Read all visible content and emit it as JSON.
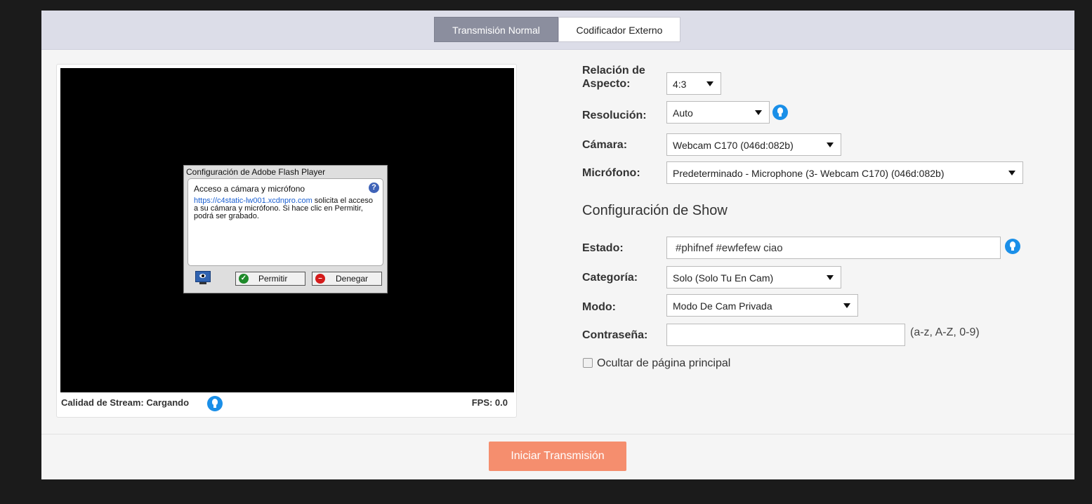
{
  "tabs": [
    {
      "label": "Transmisión Normal",
      "active": true
    },
    {
      "label": "Codificador Externo",
      "active": false
    }
  ],
  "flash_dialog": {
    "title": "Configuración de Adobe Flash Player",
    "heading": "Acceso a cámara y micrófono",
    "link": "https://c4static-lw001.xcdnpro.com",
    "message_rest": " solicita el acceso a su cámara y micrófono. Si hace clic en Permitir, podrá ser grabado.",
    "allow_label": "Permitir",
    "deny_label": "Denegar",
    "help_glyph": "?"
  },
  "stream": {
    "quality_text": "Calidad de Stream: Cargando",
    "fps_text": "FPS: 0.0"
  },
  "settings": {
    "aspect_label": "Relación de Aspecto:",
    "aspect_value": "4:3",
    "resolution_label": "Resolución:",
    "resolution_value": "Auto",
    "camera_label": "Cámara:",
    "camera_value": "Webcam C170 (046d:082b)",
    "mic_label": "Micrófono:",
    "mic_value": "Predeterminado - Microphone (3- Webcam C170) (046d:082b)"
  },
  "show": {
    "section_title": "Configuración de Show",
    "status_label": "Estado:",
    "status_value": "#phifnef #ewfefew ciao",
    "category_label": "Categoría:",
    "category_value": "Solo (Solo Tu En Cam)",
    "mode_label": "Modo:",
    "mode_value": "Modo De Cam Privada",
    "password_label": "Contraseña:",
    "password_value": "",
    "password_hint": "(a-z, A-Z, 0-9)",
    "hide_label": "Ocultar de página principal",
    "hide_checked": false
  },
  "start_button": "Iniciar Transmisión",
  "colors": {
    "accent_button": "#f58e6e",
    "info_icon": "#1a8fe8",
    "active_tab": "#8b8e9e"
  },
  "icons": {
    "info": "lightbulb-icon",
    "dropdown": "caret-down-icon",
    "flash_screen": "monitor-eye-icon"
  }
}
